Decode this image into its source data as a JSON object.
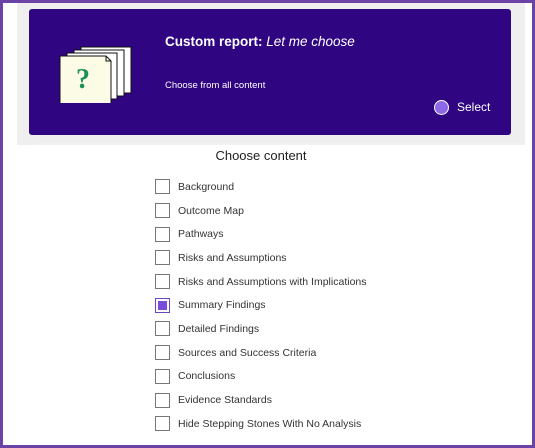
{
  "report_card": {
    "title_strong": "Custom report:",
    "title_emph": "Let me choose",
    "subtitle": "Choose from all content",
    "select_label": "Select",
    "icon": "stacked-documents-question-icon"
  },
  "content": {
    "heading": "Choose content",
    "options": [
      {
        "label": "Background",
        "checked": false
      },
      {
        "label": "Outcome Map",
        "checked": false
      },
      {
        "label": "Pathways",
        "checked": false
      },
      {
        "label": "Risks and Assumptions",
        "checked": false
      },
      {
        "label": "Risks and Assumptions with Implications",
        "checked": false
      },
      {
        "label": "Summary Findings",
        "checked": true
      },
      {
        "label": "Detailed Findings",
        "checked": false
      },
      {
        "label": "Sources and Success Criteria",
        "checked": false
      },
      {
        "label": "Conclusions",
        "checked": false
      },
      {
        "label": "Evidence Standards",
        "checked": false
      },
      {
        "label": "Hide Stepping Stones With No Analysis",
        "checked": false
      }
    ]
  },
  "colors": {
    "card_bg": "#2f0582",
    "frame_border": "#6b43a6",
    "radio_fill": "#8d68e8",
    "checkbox_fill": "#7b4bdb"
  }
}
